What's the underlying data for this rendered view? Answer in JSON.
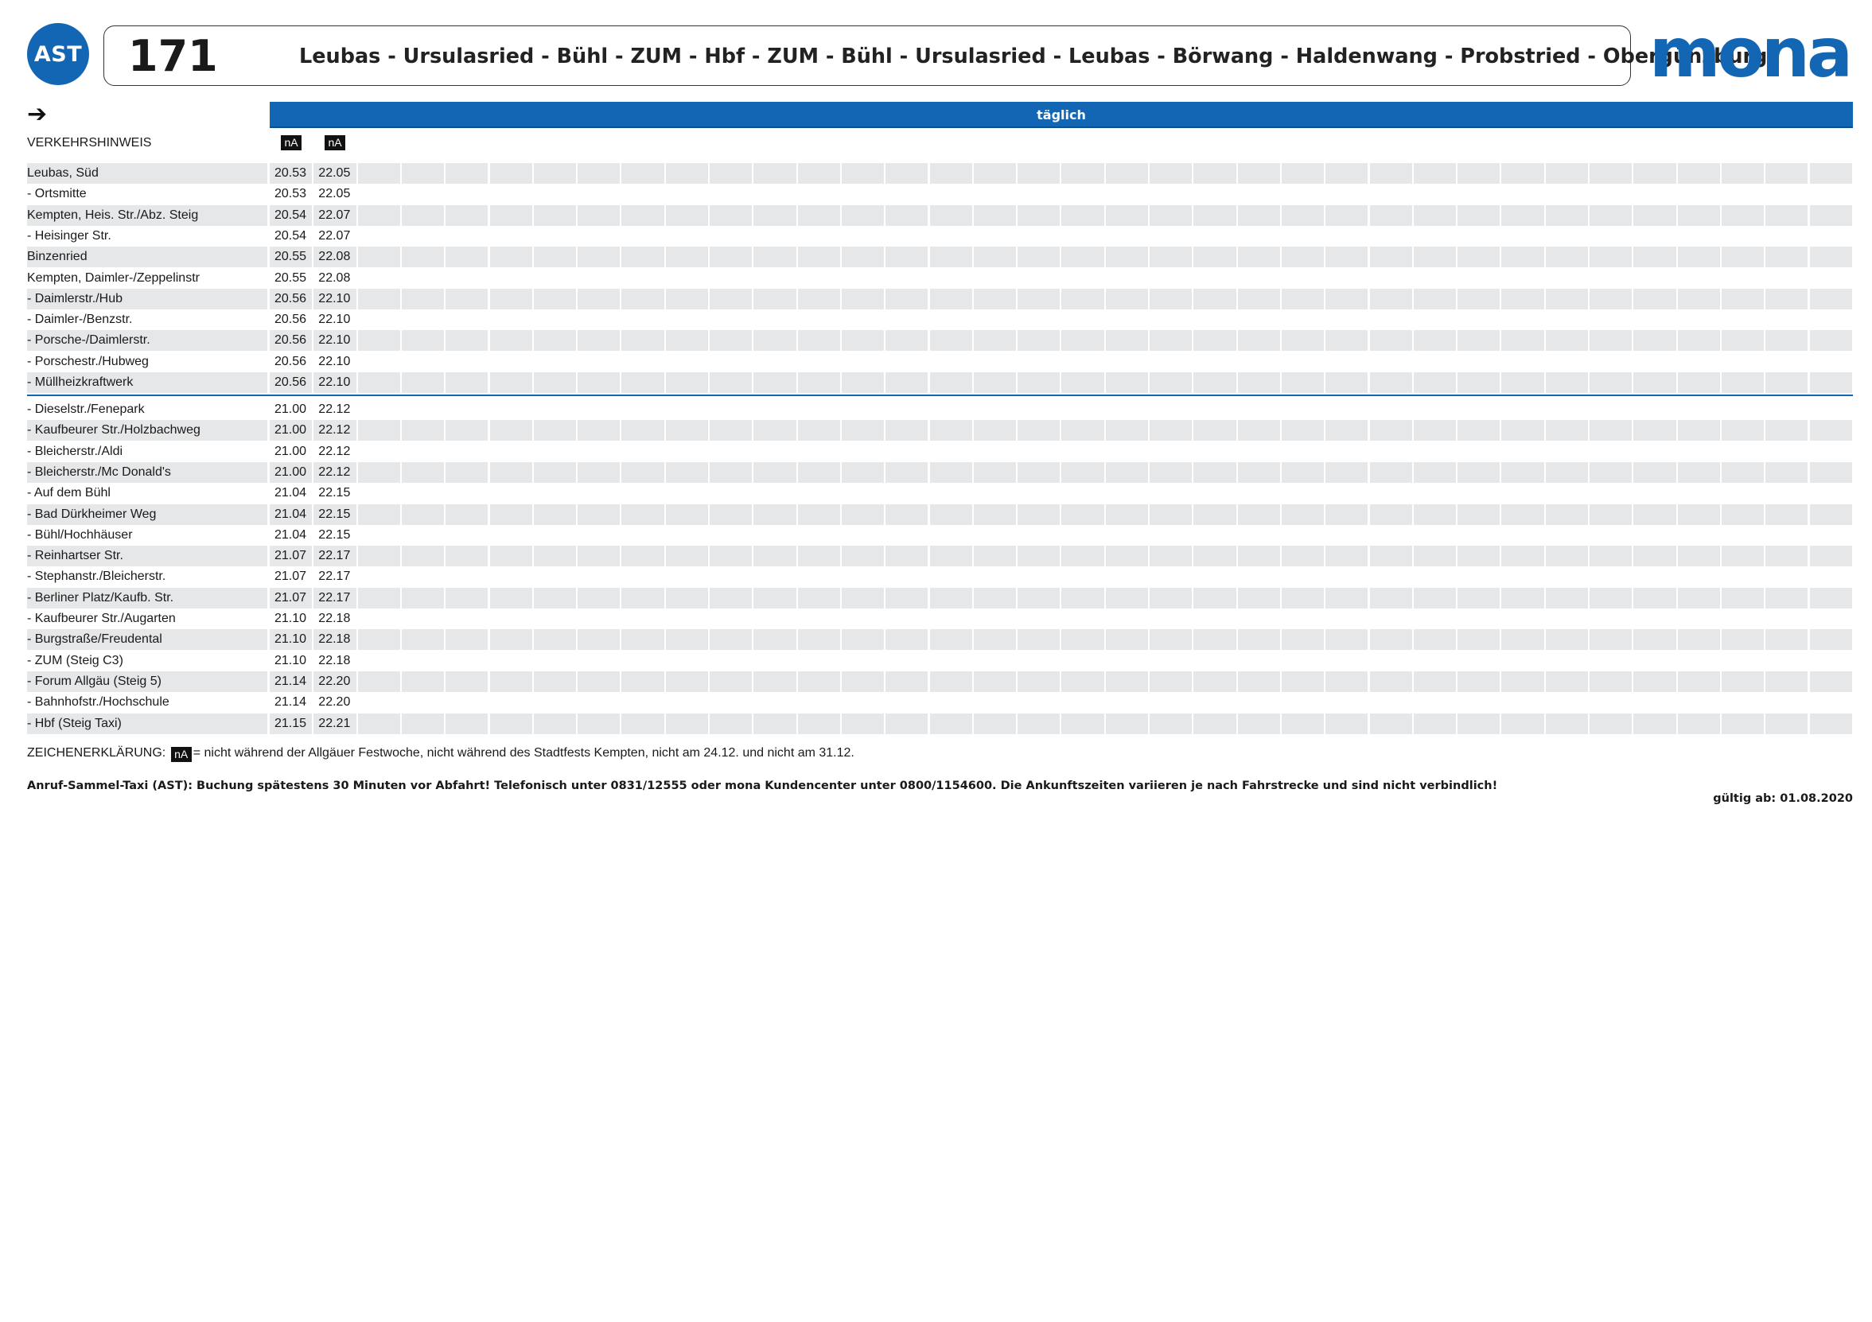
{
  "header": {
    "badge": "AST",
    "line_number": "171",
    "route": "Leubas - Ursulasried - Bühl - ZUM - Hbf - ZUM - Bühl - Ursulasried - Leubas - Börwang - Haldenwang - Probstried - Obergünzburg",
    "brand": "mona",
    "brand_color": "#1366b4"
  },
  "table": {
    "direction_icon": "arrow-right-icon",
    "days_label": "täglich",
    "notes_label": "VERKEHRSHINWEIS",
    "notes": [
      "nA",
      "nA"
    ],
    "stops_group1": [
      {
        "name": "Leubas, Süd",
        "times": [
          "20.53",
          "22.05"
        ]
      },
      {
        "name": "- Ortsmitte",
        "times": [
          "20.53",
          "22.05"
        ]
      },
      {
        "name": "Kempten, Heis. Str./Abz. Steig",
        "times": [
          "20.54",
          "22.07"
        ]
      },
      {
        "name": "- Heisinger Str.",
        "times": [
          "20.54",
          "22.07"
        ]
      },
      {
        "name": "Binzenried",
        "times": [
          "20.55",
          "22.08"
        ]
      },
      {
        "name": "Kempten, Daimler-/Zeppelinstr",
        "times": [
          "20.55",
          "22.08"
        ]
      },
      {
        "name": "- Daimlerstr./Hub",
        "times": [
          "20.56",
          "22.10"
        ]
      },
      {
        "name": "- Daimler-/Benzstr.",
        "times": [
          "20.56",
          "22.10"
        ]
      },
      {
        "name": "- Porsche-/Daimlerstr.",
        "times": [
          "20.56",
          "22.10"
        ]
      },
      {
        "name": "- Porschestr./Hubweg",
        "times": [
          "20.56",
          "22.10"
        ]
      },
      {
        "name": "- Müllheizkraftwerk",
        "times": [
          "20.56",
          "22.10"
        ]
      }
    ],
    "stops_group2": [
      {
        "name": "- Dieselstr./Fenepark",
        "times": [
          "21.00",
          "22.12"
        ]
      },
      {
        "name": "- Kaufbeurer Str./Holzbachweg",
        "times": [
          "21.00",
          "22.12"
        ]
      },
      {
        "name": "- Bleicherstr./Aldi",
        "times": [
          "21.00",
          "22.12"
        ]
      },
      {
        "name": "- Bleicherstr./Mc Donald's",
        "times": [
          "21.00",
          "22.12"
        ]
      },
      {
        "name": "- Auf dem Bühl",
        "times": [
          "21.04",
          "22.15"
        ]
      },
      {
        "name": "- Bad Dürkheimer Weg",
        "times": [
          "21.04",
          "22.15"
        ]
      },
      {
        "name": "- Bühl/Hochhäuser",
        "times": [
          "21.04",
          "22.15"
        ]
      },
      {
        "name": "- Reinhartser Str.",
        "times": [
          "21.07",
          "22.17"
        ]
      },
      {
        "name": "- Stephanstr./Bleicherstr.",
        "times": [
          "21.07",
          "22.17"
        ]
      },
      {
        "name": "- Berliner Platz/Kaufb. Str.",
        "times": [
          "21.07",
          "22.17"
        ]
      },
      {
        "name": "- Kaufbeurer Str./Augarten",
        "times": [
          "21.10",
          "22.18"
        ]
      },
      {
        "name": "- Burgstraße/Freudental",
        "times": [
          "21.10",
          "22.18"
        ]
      },
      {
        "name": "- ZUM (Steig C3)",
        "times": [
          "21.10",
          "22.18"
        ]
      },
      {
        "name": "- Forum Allgäu (Steig 5)",
        "times": [
          "21.14",
          "22.20"
        ]
      },
      {
        "name": "- Bahnhofstr./Hochschule",
        "times": [
          "21.14",
          "22.20"
        ]
      },
      {
        "name": "- Hbf (Steig Taxi)",
        "times": [
          "21.15",
          "22.21"
        ]
      }
    ]
  },
  "legend": {
    "prefix": "ZEICHENERKLÄRUNG:",
    "symbol": "nA",
    "text": "= nicht während der Allgäuer Festwoche, nicht während des Stadtfests Kempten, nicht am 24.12. und nicht am 31.12."
  },
  "footer": {
    "info": "Anruf-Sammel-Taxi (AST): Buchung spätestens 30 Minuten vor Abfahrt! Telefonisch unter 0831/12555 oder mona Kundencenter unter 0800/1154600. Die Ankunftszeiten variieren je nach Fahrstrecke und sind nicht verbindlich!",
    "valid_from": "gültig ab: 01.08.2020"
  }
}
